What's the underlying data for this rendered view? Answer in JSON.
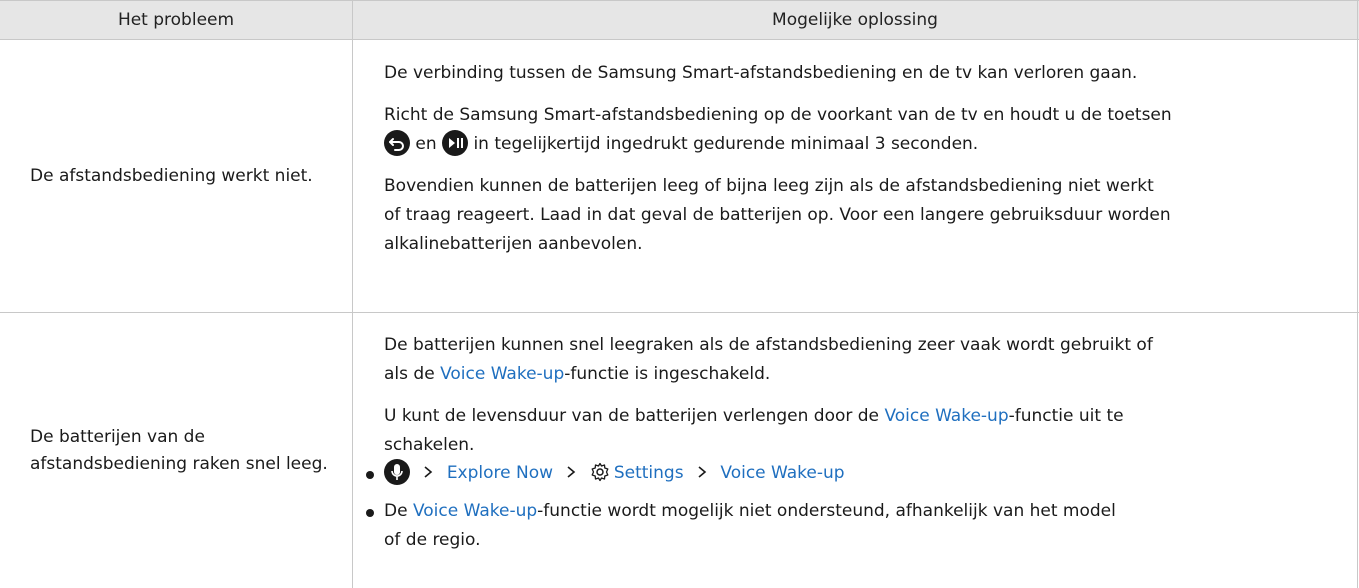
{
  "header": {
    "col1": "Het probleem",
    "col2": "Mogelijke oplossing"
  },
  "rows": [
    {
      "problem": "De afstandsbediening werkt niet.",
      "p1": "De verbinding tussen de Samsung Smart-afstandsbediening en de tv kan verloren gaan.",
      "p2_line1": "Richt de Samsung Smart-afstandsbediening op de voorkant van de tv en houdt u de toetsen",
      "p2_en": "en",
      "p2_line2": "in tegelijkertijd ingedrukt gedurende minimaal 3 seconden.",
      "p3_line1": "Bovendien kunnen de batterijen leeg of bijna leeg zijn als de afstandsbediening niet werkt",
      "p3_line2": "of traag reageert. Laad in dat geval de batterijen op. Voor een langere gebruiksduur worden",
      "p3_line3": "alkalinebatterijen aanbevolen."
    },
    {
      "problem": "De batterijen van de afstandsbediening raken snel leeg.",
      "p1_line1": "De batterijen kunnen snel leegraken als de afstandsbediening zeer vaak wordt gebruikt of",
      "p1_als": "als de",
      "p1_link": "Voice Wake-up",
      "p1_rest": "-functie is ingeschakeld.",
      "p2_pre": "U kunt de levensduur van de batterijen verlengen door de",
      "p2_link": "Voice Wake-up",
      "p2_post": "-functie uit te",
      "p2_line2": "schakelen.",
      "path": {
        "item1": "Explore Now",
        "item2": "Settings",
        "item3": "Voice Wake-up"
      },
      "note_pre": "De",
      "note_link": "Voice Wake-up",
      "note_post": "-functie wordt mogelijk niet ondersteund, afhankelijk van het model",
      "note_line2": "of de regio."
    }
  ],
  "icons": {
    "back": "back-button-icon",
    "play_pause": "play-pause-button-icon",
    "mic": "microphone-icon",
    "gear": "gear-icon",
    "chevron": "chevron-right-icon"
  },
  "colors": {
    "link": "#1f6fbf",
    "header_bg": "#e6e6e6",
    "border": "#c8c8c8"
  }
}
